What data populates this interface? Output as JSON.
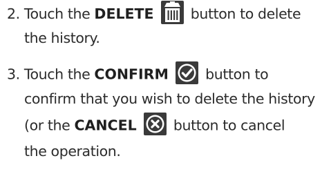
{
  "steps": [
    {
      "number": "2.",
      "parts": {
        "before": "Touch the",
        "keyword": "DELETE",
        "after": "button to delete",
        "line2": "the history."
      },
      "icon": "trash-icon"
    },
    {
      "number": "3.",
      "parts": {
        "before": "Touch the",
        "keyword": "CONFIRM",
        "after": "button to",
        "line2": "confirm that you wish to delete the history",
        "line3_before": "(or the",
        "line3_keyword": "CANCEL",
        "line3_after": "button to cancel",
        "line4": "the operation."
      },
      "icons": [
        "check-icon",
        "cancel-icon"
      ]
    }
  ],
  "colors": {
    "text": "#2b2b2b",
    "icon_bg": "#3a3a3a",
    "icon_fg": "#ffffff"
  }
}
